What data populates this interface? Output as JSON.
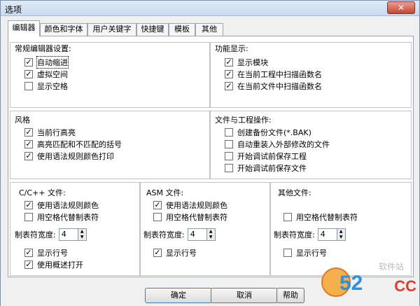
{
  "window": {
    "title": "选项",
    "close_icon": "close-icon"
  },
  "tabs": [
    "编辑器",
    "颜色和字体",
    "用户关键字",
    "快捷键",
    "模板",
    "其他"
  ],
  "groups": {
    "editor_settings": {
      "title": "常规编辑器设置:",
      "options": [
        {
          "label": "自动缩进",
          "checked": true
        },
        {
          "label": "虚拟空间",
          "checked": true
        },
        {
          "label": "显示空格",
          "checked": false
        }
      ]
    },
    "function_display": {
      "title": "功能显示:",
      "options": [
        {
          "label": "显示模块",
          "checked": true
        },
        {
          "label": "在当前工程中扫描函数名",
          "checked": true
        },
        {
          "label": "在当前文件中扫描函数名",
          "checked": true
        }
      ]
    },
    "style": {
      "title": "风格",
      "options": [
        {
          "label": "当前行高亮",
          "checked": true
        },
        {
          "label": "高亮匹配和不匹配的括号",
          "checked": true
        },
        {
          "label": "使用语法规则颜色打印",
          "checked": true
        }
      ]
    },
    "file_project_ops": {
      "title": "文件与工程操作:",
      "options": [
        {
          "label": "创建备份文件(*.BAK)",
          "checked": false
        },
        {
          "label": "自动重装入外部修改的文件",
          "checked": false
        },
        {
          "label": "开始调试前保存工程",
          "checked": false
        },
        {
          "label": "开始调试前保存文件",
          "checked": false
        }
      ]
    },
    "cpp_files": {
      "title": "C/C++ 文件:",
      "options": [
        {
          "label": "使用语法规则颜色",
          "checked": true
        },
        {
          "label": "用空格代替制表符",
          "checked": false
        }
      ],
      "tab_width_label": "制表符宽度:",
      "tab_width": "4",
      "options2": [
        {
          "label": "显示行号",
          "checked": true
        },
        {
          "label": "使用概述打开",
          "checked": true
        }
      ]
    },
    "asm_files": {
      "title": "ASM 文件:",
      "options": [
        {
          "label": "使用语法规则颜色",
          "checked": true
        },
        {
          "label": "用空格代替制表符",
          "checked": false
        }
      ],
      "tab_width_label": "制表符宽度:",
      "tab_width": "4",
      "options2": [
        {
          "label": "显示行号",
          "checked": true
        }
      ]
    },
    "other_files": {
      "title": "其他文件:",
      "options": [
        {
          "label": "用空格代替制表符",
          "checked": false
        }
      ],
      "tab_width_label": "制表符宽度:",
      "tab_width": "4",
      "options2": [
        {
          "label": "显示行号",
          "checked": false
        }
      ]
    }
  },
  "buttons": {
    "ok": "确定",
    "cancel": "取消",
    "help_partial": "帮助"
  },
  "watermark": {
    "top_text": "软件站",
    "number": "52",
    "suffix": "CC"
  }
}
